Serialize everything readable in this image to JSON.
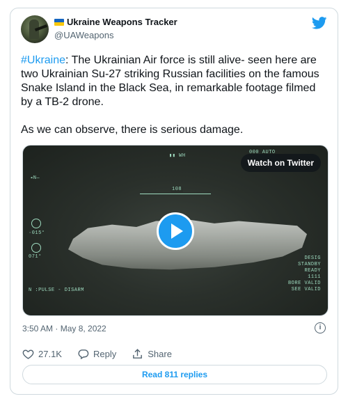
{
  "author": {
    "name": "Ukraine Weapons Tracker",
    "handle": "@UAWeapons",
    "flag_colors": [
      "#1565c0",
      "#f9c80e"
    ]
  },
  "tweet": {
    "hashtag": "#Ukraine",
    "body": ": The Ukrainian Air force is still alive- seen here are two Ukrainian Su-27 striking Russian facilities on the famous Snake Island in the Black Sea, in remarkable footage filmed by a TB-2 drone.",
    "body2": "As we can observe, there is serious damage.",
    "timestamp": "3:50 AM · May 8, 2022"
  },
  "media": {
    "watch_label": "Watch on Twitter",
    "hud": {
      "top": "▮▮  WH",
      "top_right": "000    AUTO",
      "n": "◂N—",
      "heading": "108",
      "v015": "·015°",
      "v071": "071°",
      "pulse": "N :PULSE - DISARM",
      "right_1": "DESIG",
      "right_2": "STANDBY",
      "right_3": "READY",
      "right_4": "1111",
      "right_5": "BORE VALID",
      "right_6": "SEE VALID"
    }
  },
  "actions": {
    "likes": "27.1K",
    "reply": "Reply",
    "share": "Share"
  },
  "read_replies": "Read 811 replies",
  "colors": {
    "accent": "#1d9bf0",
    "text": "#0f1419",
    "muted": "#536471",
    "border": "#cfd9de"
  },
  "icons": [
    "twitter-bird-icon",
    "heart-icon",
    "reply-icon",
    "share-icon",
    "info-icon",
    "play-icon"
  ]
}
